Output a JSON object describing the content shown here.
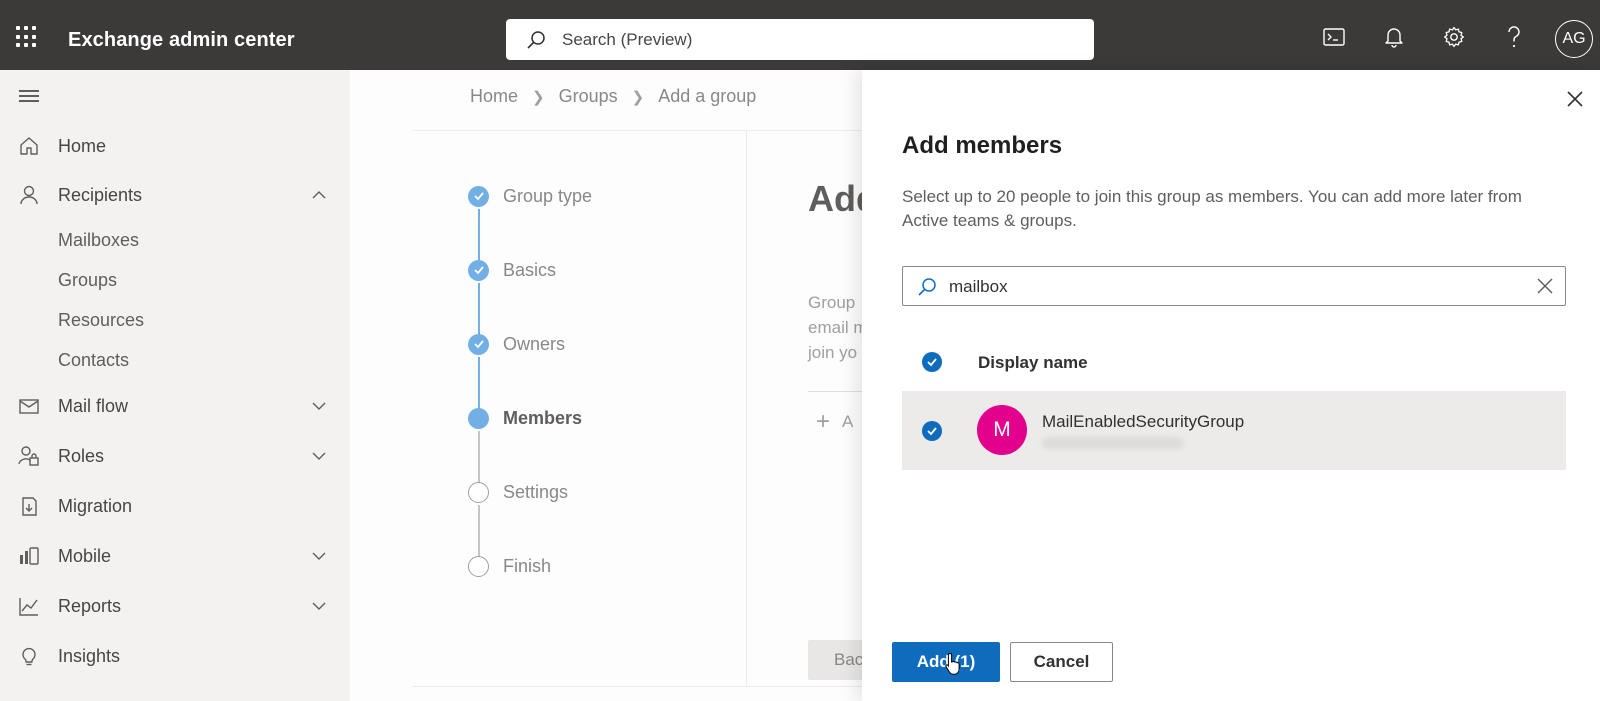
{
  "app": {
    "title": "Exchange admin center"
  },
  "search": {
    "placeholder": "Search (Preview)"
  },
  "topbar": {
    "icons": [
      "terminal-icon",
      "bell-icon",
      "gear-icon",
      "help-icon"
    ],
    "avatar_initials": "AG"
  },
  "nav": {
    "items": [
      {
        "label": "Home",
        "icon": "home-icon"
      },
      {
        "label": "Recipients",
        "icon": "person-icon",
        "expanded": true
      },
      {
        "label": "Mail flow",
        "icon": "mail-icon",
        "expanded": false
      },
      {
        "label": "Roles",
        "icon": "roles-icon",
        "expanded": false
      },
      {
        "label": "Migration",
        "icon": "migration-icon"
      },
      {
        "label": "Mobile",
        "icon": "mobile-icon",
        "expanded": false
      },
      {
        "label": "Reports",
        "icon": "reports-icon",
        "expanded": false
      },
      {
        "label": "Insights",
        "icon": "lightbulb-icon"
      }
    ],
    "recipients_sub": [
      "Mailboxes",
      "Groups",
      "Resources",
      "Contacts"
    ]
  },
  "breadcrumb": [
    "Home",
    "Groups",
    "Add a group"
  ],
  "wizard": {
    "steps": [
      {
        "label": "Group type",
        "state": "done"
      },
      {
        "label": "Basics",
        "state": "done"
      },
      {
        "label": "Owners",
        "state": "done"
      },
      {
        "label": "Members",
        "state": "current"
      },
      {
        "label": "Settings",
        "state": "todo"
      },
      {
        "label": "Finish",
        "state": "todo"
      }
    ],
    "heading_partial": "Add",
    "desc_partial": [
      "Group",
      "email m",
      "join yo"
    ],
    "add_partial": "A",
    "back_partial": "Bac"
  },
  "panel": {
    "title": "Add members",
    "description": "Select up to 20 people to join this group as members. You can add more later from Active teams & groups.",
    "search_value": "mailbox",
    "column_header": "Display name",
    "results": [
      {
        "initial": "M",
        "name": "MailEnabledSecurityGroup",
        "selected": true,
        "avatar_color": "#e3008c"
      }
    ],
    "add_button": "Add (1)",
    "cancel_button": "Cancel"
  },
  "colors": {
    "accent": "#0f6cbd",
    "topbar": "#3b3a39",
    "nav_bg": "#f3f2f1",
    "step_done": "#71afe5"
  }
}
